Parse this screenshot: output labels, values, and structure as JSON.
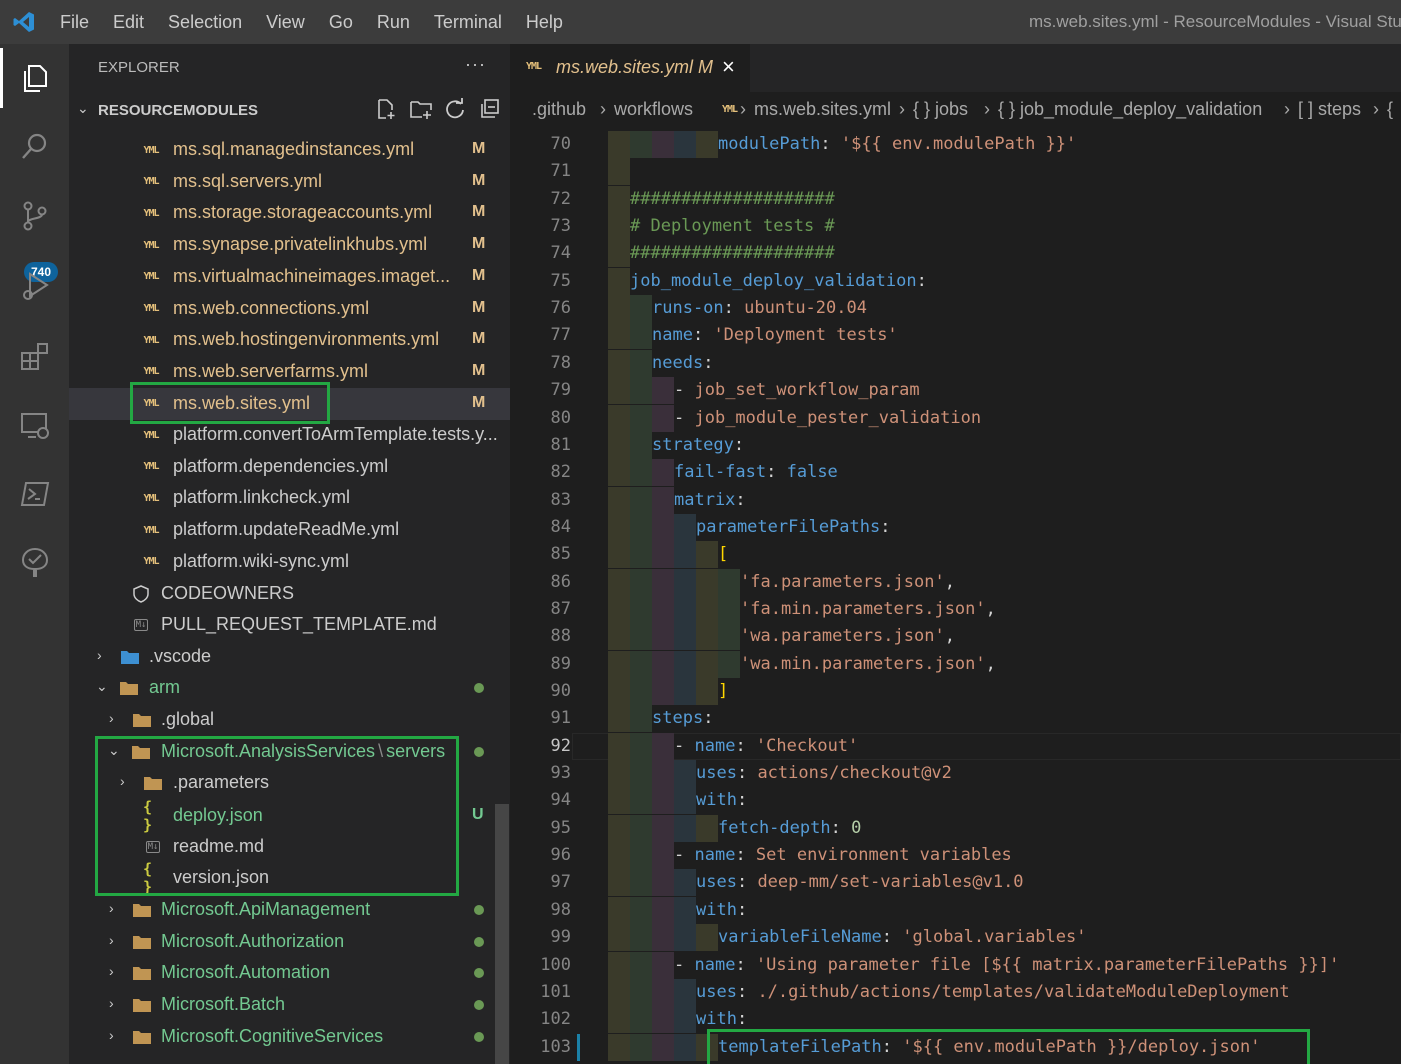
{
  "titlebar": {
    "menu": [
      "File",
      "Edit",
      "Selection",
      "View",
      "Go",
      "Run",
      "Terminal",
      "Help"
    ],
    "window_title": "ms.web.sites.yml - ResourceModules - Visual Stud"
  },
  "activity_bar": {
    "items": [
      "explorer-icon",
      "search-icon",
      "source-control-icon",
      "run-debug-icon",
      "extensions-icon",
      "remote-explorer-icon",
      "powershell-icon",
      "testing-icon"
    ],
    "source_control_badge": "740"
  },
  "sidebar": {
    "header": "EXPLORER",
    "more": "···",
    "section_title": "RESOURCEMODULES",
    "files_top": [
      {
        "name": "ms.sql.managedinstances.yml",
        "status": "M"
      },
      {
        "name": "ms.sql.servers.yml",
        "status": "M"
      },
      {
        "name": "ms.storage.storageaccounts.yml",
        "status": "M"
      },
      {
        "name": "ms.synapse.privatelinkhubs.yml",
        "status": "M"
      },
      {
        "name": "ms.virtualmachineimages.imaget...",
        "status": "M"
      },
      {
        "name": "ms.web.connections.yml",
        "status": "M"
      },
      {
        "name": "ms.web.hostingenvironments.yml",
        "status": "M"
      },
      {
        "name": "ms.web.serverfarms.yml",
        "status": "M"
      },
      {
        "name": "ms.web.sites.yml",
        "status": "M"
      }
    ],
    "files_platform": [
      "platform.convertToArmTemplate.tests.y...",
      "platform.dependencies.yml",
      "platform.linkcheck.yml",
      "platform.updateReadMe.yml",
      "platform.wiki-sync.yml"
    ],
    "codeowners": "CODEOWNERS",
    "pr_template": "PULL_REQUEST_TEMPLATE.md",
    "vscode": ".vscode",
    "arm": "arm",
    "global": ".global",
    "analysis_services": "Microsoft.AnalysisServices",
    "analysis_sep": "\\",
    "analysis_servers": "servers",
    "parameters": ".parameters",
    "deploy_json": "deploy.json",
    "deploy_status": "U",
    "readme": "readme.md",
    "version_json": "version.json",
    "providers": [
      "Microsoft.ApiManagement",
      "Microsoft.Authorization",
      "Microsoft.Automation",
      "Microsoft.Batch",
      "Microsoft.CognitiveServices"
    ]
  },
  "editor": {
    "tab_label": "ms.web.sites.yml",
    "tab_status": "M",
    "breadcrumb": [
      ".github",
      "workflows",
      "ms.web.sites.yml",
      "{ } jobs",
      "{ } job_module_deploy_validation",
      "[ ] steps",
      "{"
    ],
    "current_line": "92",
    "lines": [
      {
        "n": "70",
        "indent": 5,
        "parts": [
          [
            "k",
            "modulePath"
          ],
          [
            "p",
            ": "
          ],
          [
            "s",
            "'${{ env.modulePath }}'"
          ]
        ]
      },
      {
        "n": "71",
        "indent": 1,
        "parts": []
      },
      {
        "n": "72",
        "indent": 1,
        "parts": [
          [
            "c",
            "####################"
          ]
        ]
      },
      {
        "n": "73",
        "indent": 1,
        "parts": [
          [
            "c",
            "# Deployment tests #"
          ]
        ]
      },
      {
        "n": "74",
        "indent": 1,
        "parts": [
          [
            "c",
            "####################"
          ]
        ]
      },
      {
        "n": "75",
        "indent": 1,
        "parts": [
          [
            "k",
            "job_module_deploy_validation"
          ],
          [
            "p",
            ":"
          ]
        ]
      },
      {
        "n": "76",
        "indent": 2,
        "parts": [
          [
            "k",
            "runs-on"
          ],
          [
            "p",
            ": "
          ],
          [
            "s",
            "ubuntu-20.04"
          ]
        ]
      },
      {
        "n": "77",
        "indent": 2,
        "parts": [
          [
            "k",
            "name"
          ],
          [
            "p",
            ": "
          ],
          [
            "s",
            "'Deployment tests'"
          ]
        ]
      },
      {
        "n": "78",
        "indent": 2,
        "parts": [
          [
            "k",
            "needs"
          ],
          [
            "p",
            ":"
          ]
        ]
      },
      {
        "n": "79",
        "indent": 3,
        "parts": [
          [
            "p",
            "- "
          ],
          [
            "s",
            "job_set_workflow_param"
          ]
        ]
      },
      {
        "n": "80",
        "indent": 3,
        "parts": [
          [
            "p",
            "- "
          ],
          [
            "s",
            "job_module_pester_validation"
          ]
        ]
      },
      {
        "n": "81",
        "indent": 2,
        "parts": [
          [
            "k",
            "strategy"
          ],
          [
            "p",
            ":"
          ]
        ]
      },
      {
        "n": "82",
        "indent": 3,
        "parts": [
          [
            "k",
            "fail-fast"
          ],
          [
            "p",
            ": "
          ],
          [
            "k",
            "false"
          ]
        ]
      },
      {
        "n": "83",
        "indent": 3,
        "parts": [
          [
            "k",
            "matrix"
          ],
          [
            "p",
            ":"
          ]
        ]
      },
      {
        "n": "84",
        "indent": 4,
        "parts": [
          [
            "k",
            "parameterFilePaths"
          ],
          [
            "p",
            ":"
          ]
        ]
      },
      {
        "n": "85",
        "indent": 5,
        "parts": [
          [
            "b",
            "["
          ]
        ]
      },
      {
        "n": "86",
        "indent": 6,
        "parts": [
          [
            "s",
            "'fa.parameters.json'"
          ],
          [
            "p",
            ","
          ]
        ]
      },
      {
        "n": "87",
        "indent": 6,
        "parts": [
          [
            "s",
            "'fa.min.parameters.json'"
          ],
          [
            "p",
            ","
          ]
        ]
      },
      {
        "n": "88",
        "indent": 6,
        "parts": [
          [
            "s",
            "'wa.parameters.json'"
          ],
          [
            "p",
            ","
          ]
        ]
      },
      {
        "n": "89",
        "indent": 6,
        "parts": [
          [
            "s",
            "'wa.min.parameters.json'"
          ],
          [
            "p",
            ","
          ]
        ]
      },
      {
        "n": "90",
        "indent": 5,
        "parts": [
          [
            "b",
            "]"
          ]
        ]
      },
      {
        "n": "91",
        "indent": 2,
        "parts": [
          [
            "k",
            "steps"
          ],
          [
            "p",
            ":"
          ]
        ]
      },
      {
        "n": "92",
        "indent": 3,
        "parts": [
          [
            "p",
            "- "
          ],
          [
            "k",
            "name"
          ],
          [
            "p",
            ": "
          ],
          [
            "s",
            "'Checkout'"
          ]
        ]
      },
      {
        "n": "93",
        "indent": 4,
        "parts": [
          [
            "k",
            "uses"
          ],
          [
            "p",
            ": "
          ],
          [
            "s",
            "actions/checkout@v2"
          ]
        ]
      },
      {
        "n": "94",
        "indent": 4,
        "parts": [
          [
            "k",
            "with"
          ],
          [
            "p",
            ":"
          ]
        ]
      },
      {
        "n": "95",
        "indent": 5,
        "parts": [
          [
            "k",
            "fetch-depth"
          ],
          [
            "p",
            ": "
          ],
          [
            "nn",
            "0"
          ]
        ]
      },
      {
        "n": "96",
        "indent": 3,
        "parts": [
          [
            "p",
            "- "
          ],
          [
            "k",
            "name"
          ],
          [
            "p",
            ": "
          ],
          [
            "s",
            "Set environment variables"
          ]
        ]
      },
      {
        "n": "97",
        "indent": 4,
        "parts": [
          [
            "k",
            "uses"
          ],
          [
            "p",
            ": "
          ],
          [
            "s",
            "deep-mm/set-variables@v1.0"
          ]
        ]
      },
      {
        "n": "98",
        "indent": 4,
        "parts": [
          [
            "k",
            "with"
          ],
          [
            "p",
            ":"
          ]
        ]
      },
      {
        "n": "99",
        "indent": 5,
        "parts": [
          [
            "k",
            "variableFileName"
          ],
          [
            "p",
            ": "
          ],
          [
            "s",
            "'global.variables'"
          ]
        ]
      },
      {
        "n": "100",
        "indent": 3,
        "parts": [
          [
            "p",
            "- "
          ],
          [
            "k",
            "name"
          ],
          [
            "p",
            ": "
          ],
          [
            "s",
            "'Using parameter file [${{ matrix.parameterFilePaths }}]'"
          ]
        ]
      },
      {
        "n": "101",
        "indent": 4,
        "parts": [
          [
            "k",
            "uses"
          ],
          [
            "p",
            ": "
          ],
          [
            "s",
            "./.github/actions/templates/validateModuleDeployment"
          ]
        ]
      },
      {
        "n": "102",
        "indent": 4,
        "parts": [
          [
            "k",
            "with"
          ],
          [
            "p",
            ":"
          ]
        ]
      },
      {
        "n": "103",
        "indent": 5,
        "parts": [
          [
            "k",
            "templateFilePath"
          ],
          [
            "p",
            ": "
          ],
          [
            "s",
            "'${{ env.modulePath }}/deploy.json'"
          ]
        ]
      }
    ]
  },
  "colors": {
    "highlight_box": "#23a843",
    "modified": "#e2c08d",
    "untracked": "#73c991",
    "keyword": "#569cd6",
    "string": "#ce9178",
    "comment": "#6a9955"
  }
}
